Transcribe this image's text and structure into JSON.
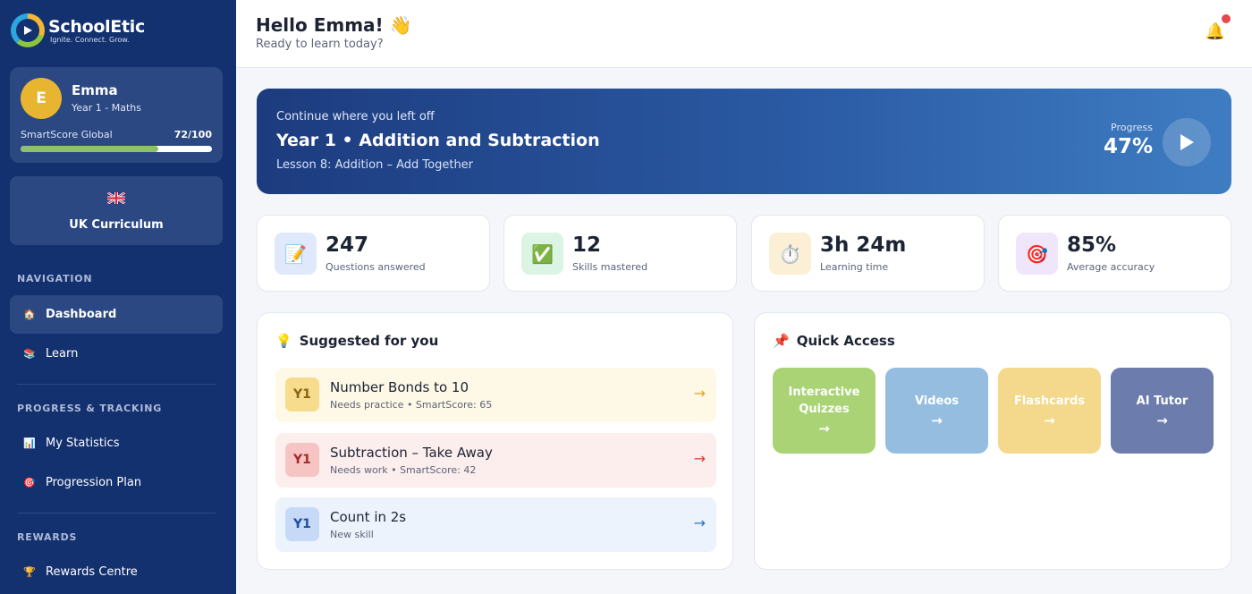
{
  "brand": {
    "name": "SchoolEtic",
    "tagline": "Ignite. Connect. Grow."
  },
  "profile": {
    "initial": "E",
    "name": "Emma",
    "subtitle": "Year 1 - Maths",
    "score_label": "SmartScore Global",
    "score_value": "72/100",
    "score_fraction": 0.72
  },
  "curriculum": {
    "label": "UK Curriculum",
    "flag_icon": "uk-flag-icon"
  },
  "nav": {
    "section_navigation": "NAVIGATION",
    "dashboard": "Dashboard",
    "learn": "Learn",
    "section_progress": "PROGRESS & TRACKING",
    "statistics": "My Statistics",
    "progression": "Progression Plan",
    "section_rewards": "REWARDS",
    "rewards": "Rewards Centre"
  },
  "header": {
    "greeting": "Hello Emma! 👋",
    "subtitle": "Ready to learn today?"
  },
  "hero": {
    "kicker": "Continue where you left off",
    "title": "Year 1 • Addition and Subtraction",
    "lesson": "Lesson 8: Addition – Add Together",
    "progress_label": "Progress",
    "progress_value": "47%"
  },
  "stats": [
    {
      "icon": "📝",
      "value": "247",
      "label": "Questions answered",
      "bg": "#dfe9fb"
    },
    {
      "icon": "✅",
      "value": "12",
      "label": "Skills mastered",
      "bg": "#dcf4e3"
    },
    {
      "icon": "⏱️",
      "value": "3h 24m",
      "label": "Learning time",
      "bg": "#fbf0d6"
    },
    {
      "icon": "🎯",
      "value": "85%",
      "label": "Average accuracy",
      "bg": "#f0e6fb"
    }
  ],
  "suggested": {
    "title": "Suggested for you",
    "items": [
      {
        "badge": "Y1",
        "title": "Number Bonds to 10",
        "meta": "Needs practice • SmartScore: 65",
        "arrow": "→"
      },
      {
        "badge": "Y1",
        "title": "Subtraction – Take Away",
        "meta": "Needs work • SmartScore: 42",
        "arrow": "→"
      },
      {
        "badge": "Y1",
        "title": "Count in 2s",
        "meta": "New skill",
        "arrow": "→"
      }
    ]
  },
  "quick": {
    "title": "Quick Access",
    "items": [
      {
        "line1": "Interactive",
        "line2": "Quizzes",
        "arrow": "→",
        "color": "#a9d374"
      },
      {
        "line1": "Videos",
        "line2": "",
        "arrow": "→",
        "color": "#95bde0"
      },
      {
        "line1": "Flashcards",
        "line2": "",
        "arrow": "→",
        "color": "#f4d88b"
      },
      {
        "line1": "AI Tutor",
        "line2": "",
        "arrow": "→",
        "color": "#6c7cac"
      }
    ]
  }
}
